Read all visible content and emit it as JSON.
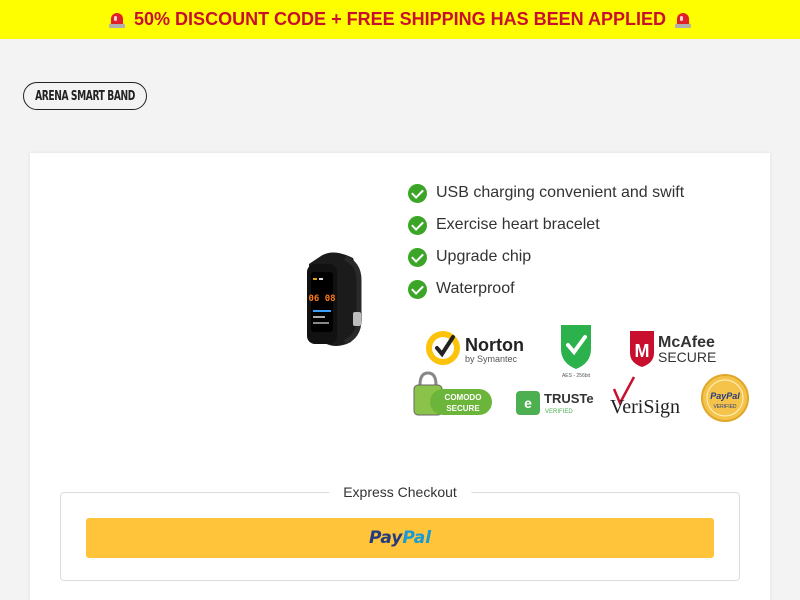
{
  "banner": {
    "text": "50% DISCOUNT CODE + FREE SHIPPING HAS BEEN APPLIED",
    "icon": "police-siren-icon"
  },
  "brand": {
    "logo_text": "ARENA SMART BAND"
  },
  "product": {
    "image": "smart-band-product-image",
    "watch_time": "06 08"
  },
  "features": [
    {
      "label": "USB charging convenient and swift"
    },
    {
      "label": "Exercise heart bracelet"
    },
    {
      "label": "Upgrade chip"
    },
    {
      "label": "Waterproof"
    }
  ],
  "trust_badges": {
    "norton": {
      "name": "Norton",
      "sub": "by Symantec"
    },
    "aes": {
      "sub": "AES - 256bit"
    },
    "mcafee": {
      "name": "McAfee",
      "sub": "SECURE"
    },
    "comodo": {
      "name": "COMODO",
      "sub": "SECURE"
    },
    "truste": {
      "name": "TRUSTe",
      "sub": "VERIFIED"
    },
    "verisign": {
      "name": "VeriSign"
    },
    "paypal_verified": {
      "name": "PayPal",
      "sub": "VERIFIED"
    }
  },
  "checkout": {
    "express_label": "Express Checkout",
    "paypal_part1": "Pay",
    "paypal_part2": "Pal"
  },
  "colors": {
    "banner_bg": "#fefe00",
    "banner_text": "#c8102e",
    "check_green": "#3aa526",
    "paypal_button": "#ffc439"
  }
}
